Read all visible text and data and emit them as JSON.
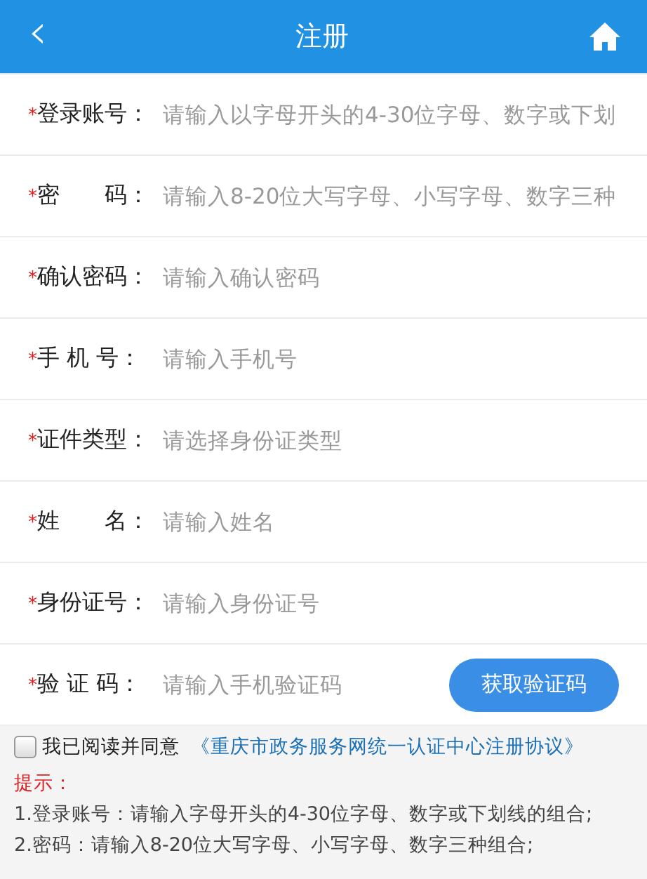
{
  "header": {
    "back": "‹",
    "title": "注册"
  },
  "fields": [
    {
      "required": "*",
      "label": "登录账号：",
      "placeholder": "请输入以字母开头的4-30位字母、数字或下划"
    },
    {
      "required": "*",
      "label": "密　　码：",
      "placeholder": "请输入8-20位大写字母、小写字母、数字三种"
    },
    {
      "required": "*",
      "label": "确认密码：",
      "placeholder": "请输入确认密码"
    },
    {
      "required": "*",
      "label": "手 机 号：",
      "placeholder": "请输入手机号"
    },
    {
      "required": "*",
      "label": "证件类型：",
      "placeholder": "请选择身份证类型"
    },
    {
      "required": "*",
      "label": "姓　　名：",
      "placeholder": "请输入姓名"
    },
    {
      "required": "*",
      "label": "身份证号：",
      "placeholder": "请输入身份证号"
    },
    {
      "required": "*",
      "label": "验 证 码：",
      "placeholder": "请输入手机验证码",
      "button": "获取验证码"
    }
  ],
  "agreement": {
    "checked": false,
    "text": "我已阅读并同意",
    "link": "《重庆市政务服务网统一认证中心注册协议》"
  },
  "tips": {
    "title": "提示：",
    "lines": [
      "1.登录账号：请输入字母开头的4-30位字母、数字或下划线的组合;",
      "2.密码：请输入8-20位大写字母、小写字母、数字三种组合;"
    ]
  }
}
